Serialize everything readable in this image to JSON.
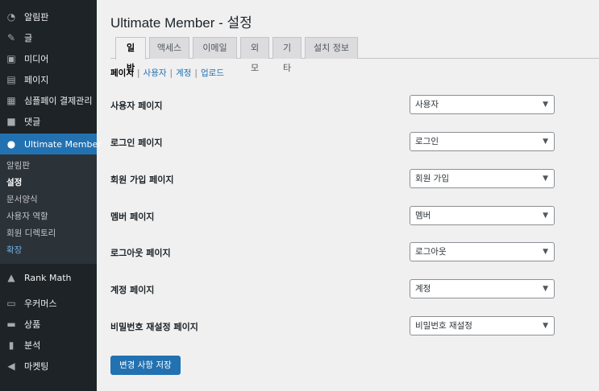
{
  "sidebar": {
    "items_top": [
      {
        "icon": "dashboard-icon",
        "glyph": "◔",
        "label": "알림판"
      },
      {
        "icon": "pin-icon",
        "glyph": "✎",
        "label": "글"
      },
      {
        "icon": "media-icon",
        "glyph": "▣",
        "label": "미디어"
      },
      {
        "icon": "page-icon",
        "glyph": "▤",
        "label": "페이지"
      },
      {
        "icon": "payment-icon",
        "glyph": "▦",
        "label": "심플페이 결제관리"
      },
      {
        "icon": "comment-icon",
        "glyph": "■",
        "label": "댓글"
      }
    ],
    "active": {
      "icon": "user-icon",
      "glyph": "●",
      "label": "Ultimate Member"
    },
    "submenu": [
      "알림판",
      "설정",
      "문서양식",
      "사용자 역할",
      "회원 디렉토리",
      "확장"
    ],
    "items_bottom": [
      {
        "icon": "rank-math-icon",
        "glyph": "▲",
        "label": "Rank Math"
      },
      {
        "icon": "woo-icon",
        "glyph": "▭",
        "label": "우커머스"
      },
      {
        "icon": "products-icon",
        "glyph": "▬",
        "label": "상품"
      },
      {
        "icon": "analytics-icon",
        "glyph": "▮",
        "label": "분석"
      },
      {
        "icon": "marketing-icon",
        "glyph": "◀",
        "label": "마켓팅"
      }
    ]
  },
  "main": {
    "title": "Ultimate Member - 설정",
    "tabs": [
      "일반",
      "액세스",
      "이메일",
      "외모",
      "기타",
      "설치 정보"
    ],
    "subnav": {
      "current": "페이지",
      "links": [
        "사용자",
        "계정",
        "업로드"
      ],
      "separator": "|"
    },
    "rows": [
      {
        "label": "사용자 페이지",
        "value": "사용자"
      },
      {
        "label": "로그인 페이지",
        "value": "로그인"
      },
      {
        "label": "회원 가입 페이지",
        "value": "회원 가입"
      },
      {
        "label": "멤버 페이지",
        "value": "멤버"
      },
      {
        "label": "로그아웃 페이지",
        "value": "로그아웃"
      },
      {
        "label": "계정 페이지",
        "value": "계정"
      },
      {
        "label": "비밀번호 재설정 페이지",
        "value": "비밀번호 재설정"
      }
    ],
    "save_label": "변경 사항 저장"
  },
  "colors": {
    "sidebar_bg": "#1d2327",
    "accent": "#2271b1",
    "page_bg": "#f0f0f1"
  }
}
